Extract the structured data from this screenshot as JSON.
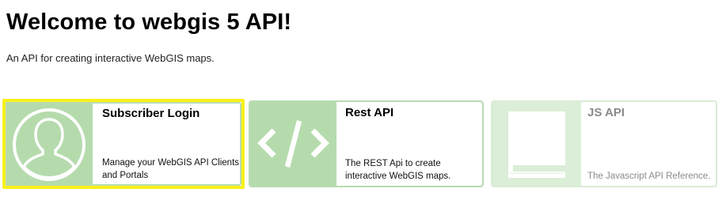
{
  "page": {
    "title": "Welcome to webgis 5 API!",
    "subtitle": "An API for creating interactive WebGIS maps."
  },
  "cards": [
    {
      "id": "login",
      "title": "Subscriber Login",
      "description": "Manage your WebGIS API Clients and Portals",
      "icon": "user-avatar-icon",
      "selected": true
    },
    {
      "id": "rest",
      "title": "Rest API",
      "description": "The REST Api to create interactive WebGIS maps.",
      "icon": "code-brackets-icon",
      "selected": false
    },
    {
      "id": "js",
      "title": "JS API",
      "description": "The Javascript API Reference.",
      "icon": "book-icon",
      "selected": false
    }
  ],
  "colors": {
    "tile_green": "#b5dbad",
    "tile_light_green": "#dbeed7",
    "border_green": "#b7dcb0",
    "selection_yellow": "#f8f11a"
  }
}
